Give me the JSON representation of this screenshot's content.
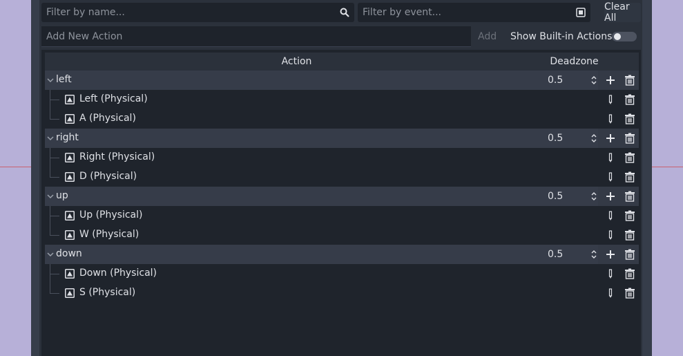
{
  "filters": {
    "name_placeholder": "Filter by name...",
    "event_placeholder": "Filter by event...",
    "clear_all_label": "Clear All"
  },
  "add_action": {
    "placeholder": "Add New Action",
    "add_label": "Add",
    "builtin_label": "Show Built-in Actions",
    "builtin_enabled": false
  },
  "table": {
    "headers": {
      "action": "Action",
      "deadzone": "Deadzone"
    },
    "actions": [
      {
        "name": "left",
        "deadzone": "0.5",
        "events": [
          "Left (Physical)",
          "A (Physical)"
        ]
      },
      {
        "name": "right",
        "deadzone": "0.5",
        "events": [
          "Right (Physical)",
          "D (Physical)"
        ]
      },
      {
        "name": "up",
        "deadzone": "0.5",
        "events": [
          "Up (Physical)",
          "W (Physical)"
        ]
      },
      {
        "name": "down",
        "deadzone": "0.5",
        "events": [
          "Down (Physical)",
          "S (Physical)"
        ]
      }
    ]
  },
  "icons": {
    "search": "search-icon",
    "event_picker": "keyboard-icon",
    "chevron": "chevron-down-icon",
    "key": "keyboard-key-icon",
    "add": "plus-icon",
    "remove": "trash-icon",
    "edit": "pencil-icon",
    "spin": "spin-arrows-icon"
  },
  "colors": {
    "background": "#b7b0d8",
    "panel": "#2b313b",
    "tree": "#1f242c",
    "action_row": "#363c49"
  }
}
